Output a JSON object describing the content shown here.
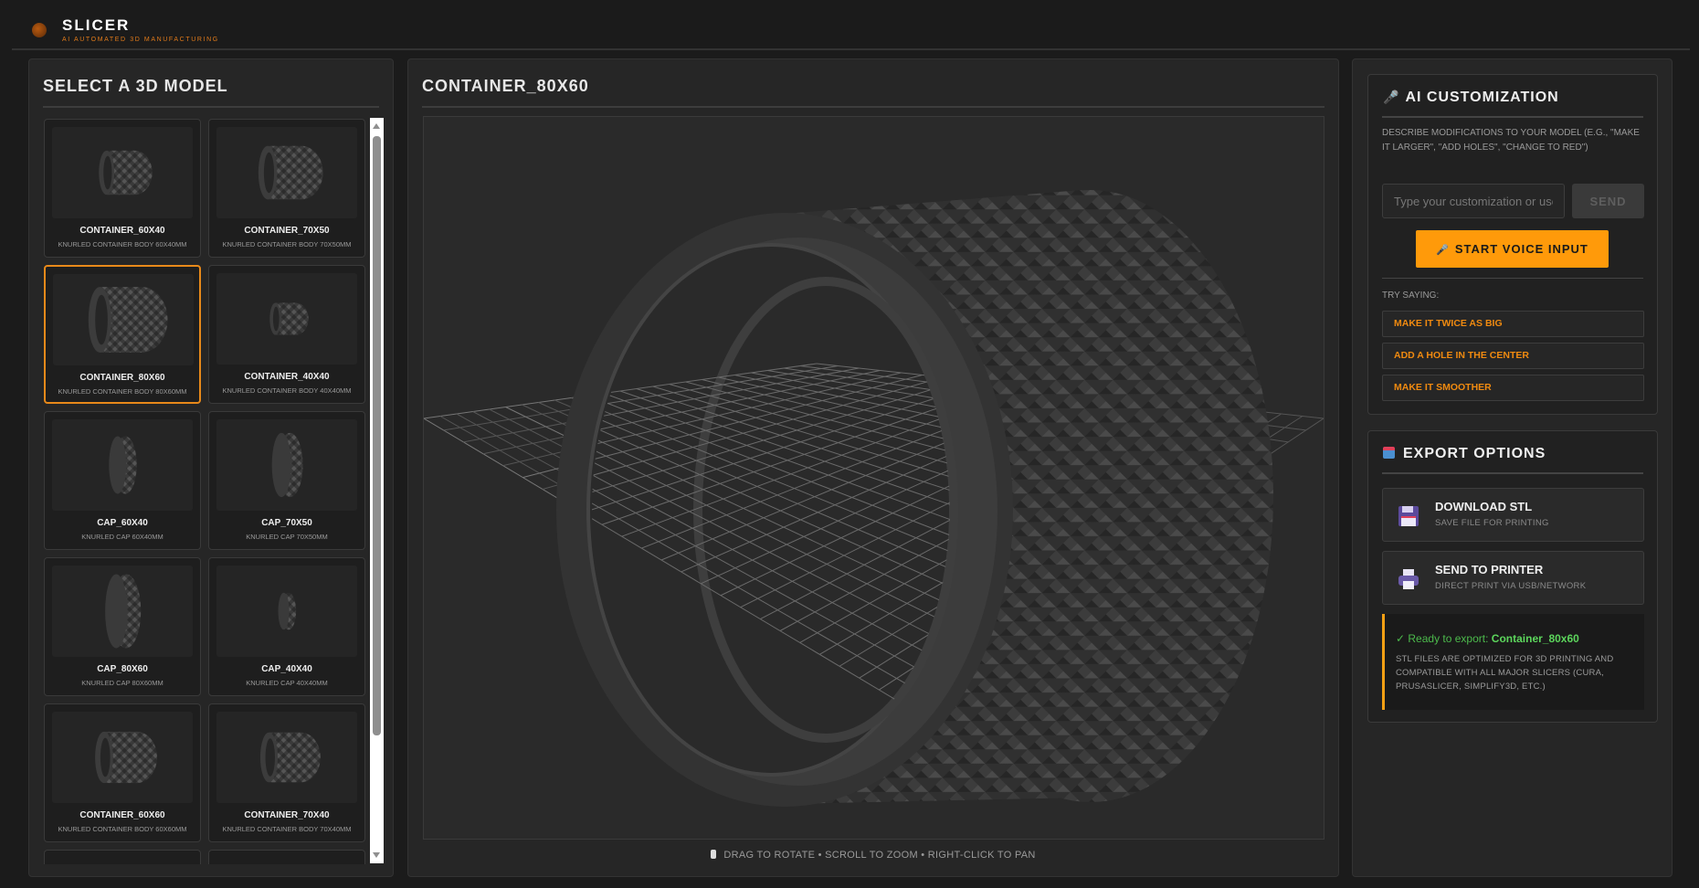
{
  "header": {
    "title": "SLICER",
    "subtitle": "AI AUTOMATED 3D MANUFACTURING"
  },
  "models_panel": {
    "title": "SELECT A 3D MODEL",
    "selected_index": 2,
    "models": [
      {
        "name": "CONTAINER_60X40",
        "desc": "KNURLED CONTAINER BODY 60X40MM",
        "kind": "container",
        "scale": 0.62
      },
      {
        "name": "CONTAINER_70X50",
        "desc": "KNURLED CONTAINER BODY 70X50MM",
        "kind": "container",
        "scale": 0.75
      },
      {
        "name": "CONTAINER_80X60",
        "desc": "KNURLED CONTAINER BODY 80X60MM",
        "kind": "container",
        "scale": 0.92
      },
      {
        "name": "CONTAINER_40X40",
        "desc": "KNURLED CONTAINER BODY 40X40MM",
        "kind": "container",
        "scale": 0.45
      },
      {
        "name": "CAP_60X40",
        "desc": "KNURLED CAP 60X40MM",
        "kind": "cap",
        "scale": 0.7
      },
      {
        "name": "CAP_70X50",
        "desc": "KNURLED CAP 70X50MM",
        "kind": "cap",
        "scale": 0.78
      },
      {
        "name": "CAP_80X60",
        "desc": "KNURLED CAP 80X60MM",
        "kind": "cap",
        "scale": 0.9
      },
      {
        "name": "CAP_40X40",
        "desc": "KNURLED CAP 40X40MM",
        "kind": "cap",
        "scale": 0.45
      },
      {
        "name": "CONTAINER_60X60",
        "desc": "KNURLED CONTAINER BODY 60X60MM",
        "kind": "container",
        "scale": 0.72
      },
      {
        "name": "CONTAINER_70X40",
        "desc": "KNURLED CONTAINER BODY 70X40MM",
        "kind": "container",
        "scale": 0.7
      }
    ]
  },
  "viewer": {
    "title": "CONTAINER_80X60",
    "hint": "DRAG TO ROTATE • SCROLL TO ZOOM • RIGHT-CLICK TO PAN",
    "hint_icon": "mouse-icon"
  },
  "ai": {
    "title": "AI CUSTOMIZATION",
    "icon": "microphone-icon",
    "description": "DESCRIBE MODIFICATIONS TO YOUR MODEL (E.G., \"MAKE IT LARGER\", \"ADD HOLES\", \"CHANGE TO RED\")",
    "input_value": "",
    "input_placeholder": "Type your customization or use voice...",
    "send_label": "SEND",
    "voice_label": "START VOICE INPUT",
    "try_label": "TRY SAYING:",
    "suggestions": [
      "MAKE IT TWICE AS BIG",
      "ADD A HOLE IN THE CENTER",
      "MAKE IT SMOOTHER"
    ]
  },
  "export": {
    "title": "EXPORT OPTIONS",
    "icon": "outbox-tray-icon",
    "download": {
      "title": "DOWNLOAD STL",
      "sub": "SAVE FILE FOR PRINTING",
      "icon": "floppy-disk-icon"
    },
    "printer": {
      "title": "SEND TO PRINTER",
      "sub": "DIRECT PRINT VIA USB/NETWORK",
      "icon": "printer-icon"
    },
    "ready_prefix": "✓ Ready to export: ",
    "ready_model": "Container_80x60",
    "note": "STL FILES ARE OPTIMIZED FOR 3D PRINTING AND COMPATIBLE WITH ALL MAJOR SLICERS (CURA, PRUSASLICER, SIMPLIFY3D, ETC.)"
  },
  "colors": {
    "accent": "#ff9a0a",
    "suggestion": "#f08a10",
    "success": "#5cd65c",
    "background": "#1b1b1b",
    "panel": "#262626"
  }
}
